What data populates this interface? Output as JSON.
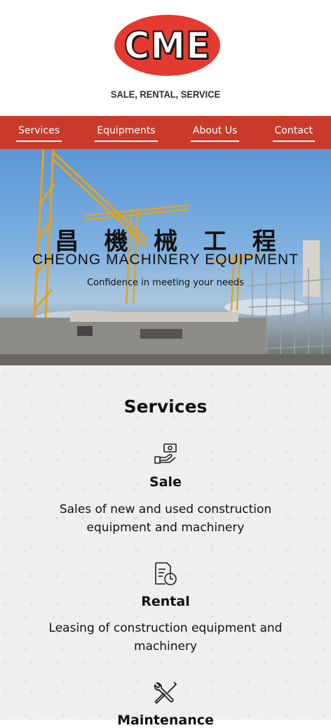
{
  "brand": {
    "logo_text": "CME",
    "tagline": "SALE, RENTAL, SERVICE",
    "logo_color": "#e53a2f"
  },
  "nav": {
    "color": "#c93a2a",
    "items": [
      {
        "label": "Services"
      },
      {
        "label": "Equipments"
      },
      {
        "label": "About Us"
      },
      {
        "label": "Contact"
      }
    ]
  },
  "hero": {
    "chinese_chars": [
      "昌",
      "機",
      "械",
      "工",
      "程"
    ],
    "title": "CHEONG MACHINERY EQUIPMENT",
    "subtitle": "Confidence in meeting your needs"
  },
  "services": {
    "title": "Services",
    "items": [
      {
        "icon": "sale-hand-money-icon",
        "name": "Sale",
        "desc": "Sales of new and used construction equipment and machinery"
      },
      {
        "icon": "rental-document-clock-icon",
        "name": "Rental",
        "desc": "Leasing of construction equipment and machinery"
      },
      {
        "icon": "wrench-screwdriver-icon",
        "name": "Maintenance",
        "desc": ""
      }
    ]
  }
}
